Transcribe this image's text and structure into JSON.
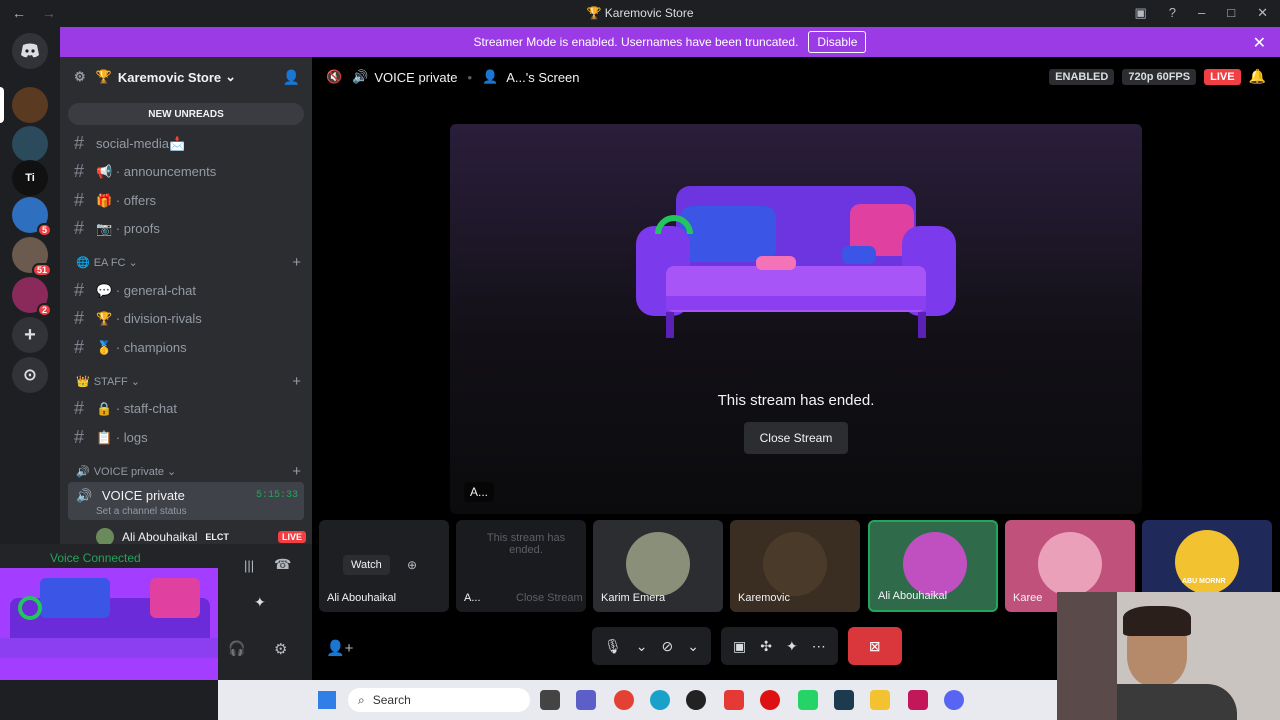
{
  "window": {
    "title": "Karemovic Store",
    "title_icon": "🏆",
    "back_icon": "←",
    "forward_icon": "→"
  },
  "banner": {
    "text": "Streamer Mode is enabled. Usernames have been truncated.",
    "button": "Disable"
  },
  "guilds": [
    {
      "badge": ""
    },
    {
      "badge": ""
    },
    {
      "badge": ""
    },
    {
      "badge": "5"
    },
    {
      "badge": "51"
    },
    {
      "badge": "2"
    }
  ],
  "server": {
    "name": "Karemovic Store",
    "icon": "🏆",
    "new_unreads": "NEW UNREADS"
  },
  "channels": [
    {
      "label": "social-media📩"
    },
    {
      "label": "📢 · announcements"
    },
    {
      "label": "🎁 · offers"
    },
    {
      "label": "📷 · proofs"
    }
  ],
  "categories": {
    "eafc": "EA FC",
    "staff": "STAFF",
    "voice": "VOICE private"
  },
  "eafc_channels": [
    {
      "label": "💬 · general-chat"
    },
    {
      "label": "🏆 · division-rivals"
    },
    {
      "label": "🥇 · champions"
    }
  ],
  "staff_channels": [
    {
      "label": "🔒 · staff-chat"
    },
    {
      "label": "📋 · logs"
    }
  ],
  "voice_channel": {
    "name": "VOICE private",
    "timer": "5:15:33",
    "status": "Set a channel status"
  },
  "voice_user": {
    "name": "Ali Abouhaikal",
    "tag": "ELCT",
    "live": "LIVE"
  },
  "voice_connected": "Voice Connected",
  "topbar": {
    "channel": "VOICE private",
    "screen": "A...'s Screen",
    "enabled": "ENABLED",
    "quality": "720p 60FPS",
    "live": "LIVE"
  },
  "stage": {
    "ended": "This stream has ended.",
    "close": "Close Stream",
    "label": "A..."
  },
  "tiles": [
    {
      "label": "Ali Abouhaikal",
      "watch": "Watch"
    },
    {
      "label": "A...",
      "overlay": "This stream has ended.",
      "close": "Close Stream"
    },
    {
      "label": "Karim Emera"
    },
    {
      "label": "Karemovic"
    },
    {
      "label": "Ali Abouhaikal"
    },
    {
      "label": "Karee"
    },
    {
      "label": "ABU MORNR"
    }
  ],
  "taskbar": {
    "search": "Search"
  },
  "colors": {
    "accent": "#9b3be6",
    "live": "#f23f43",
    "voice_green": "#23a55a",
    "end_call": "#da373c"
  }
}
